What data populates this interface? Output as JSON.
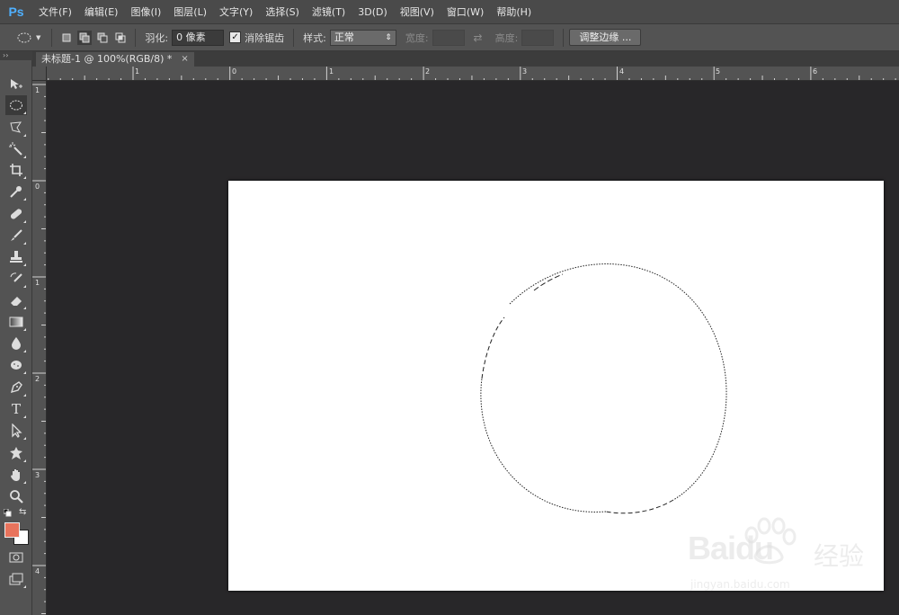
{
  "app": {
    "logo": "Ps"
  },
  "menu": [
    "文件(F)",
    "编辑(E)",
    "图像(I)",
    "图层(L)",
    "文字(Y)",
    "选择(S)",
    "滤镜(T)",
    "3D(D)",
    "视图(V)",
    "窗口(W)",
    "帮助(H)"
  ],
  "options": {
    "feather_label": "羽化:",
    "feather_value": "0 像素",
    "antialias_label": "消除锯齿",
    "antialias_checked": "✓",
    "style_label": "样式:",
    "style_value": "正常",
    "width_label": "宽度:",
    "height_label": "高度:",
    "refine_edge_button": "调整边缘 ..."
  },
  "document": {
    "tab_title": "未标题-1 @ 100%(RGB/8) *",
    "close_glyph": "×"
  },
  "rulers": {
    "horizontal": [
      "1",
      "0",
      "1",
      "2",
      "3",
      "4",
      "5",
      "6"
    ],
    "vertical": [
      "1",
      "0",
      "1",
      "2",
      "3",
      "4"
    ]
  },
  "toolbar": {
    "grip": "››",
    "tools": [
      "move-tool",
      "elliptical-marquee-tool",
      "polygonal-lasso-tool",
      "magic-wand-tool",
      "crop-tool",
      "eyedropper-tool",
      "spot-healing-brush-tool",
      "brush-tool",
      "clone-stamp-tool",
      "history-brush-tool",
      "eraser-tool",
      "gradient-tool",
      "blur-tool",
      "dodge-tool",
      "pen-tool",
      "type-tool",
      "path-selection-tool",
      "custom-shape-tool",
      "hand-tool",
      "zoom-tool"
    ],
    "type_glyph": "T",
    "foreground_color": "#e8735c",
    "background_color": "#ffffff"
  },
  "watermark": {
    "word": "Baidu",
    "cn": "经验",
    "url": "jingyan.baidu.com"
  }
}
